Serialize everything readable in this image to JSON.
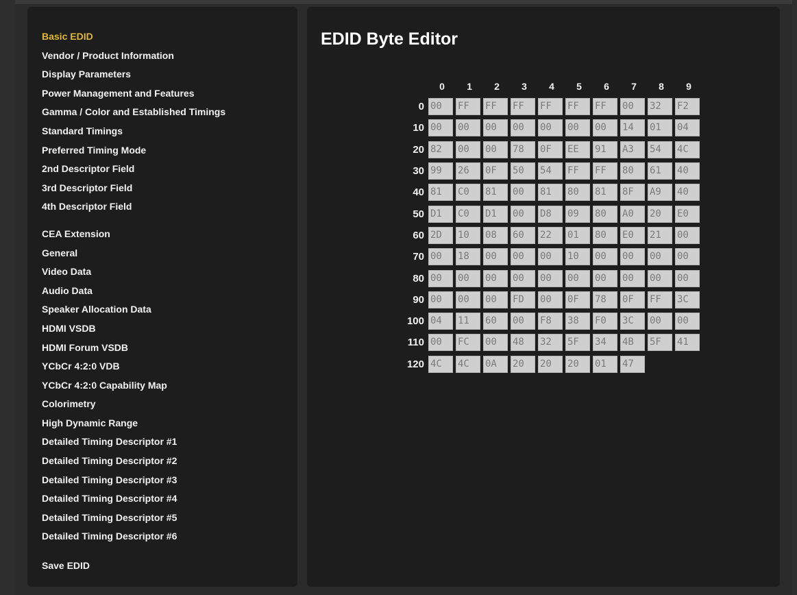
{
  "sidebar": {
    "edid_items": [
      "Basic EDID",
      "Vendor / Product Information",
      "Display Parameters",
      "Power Management and Features",
      "Gamma / Color and Established Timings",
      "Standard Timings",
      "Preferred Timing Mode",
      "2nd Descriptor Field",
      "3rd Descriptor Field",
      "4th Descriptor Field"
    ],
    "cea_items": [
      "CEA Extension",
      "General",
      "Video Data",
      "Audio Data",
      "Speaker Allocation Data",
      "HDMI VSDB",
      "HDMI Forum VSDB",
      "YCbCr 4:2:0 VDB",
      "YCbCr 4:2:0 Capability Map",
      "Colorimetry",
      "High Dynamic Range",
      "Detailed Timing Descriptor #1",
      "Detailed Timing Descriptor #2",
      "Detailed Timing Descriptor #3",
      "Detailed Timing Descriptor #4",
      "Detailed Timing Descriptor #5",
      "Detailed Timing Descriptor #6"
    ],
    "save_label": "Save EDID",
    "active_item": "Basic EDID"
  },
  "main": {
    "title": "EDID Byte Editor",
    "column_headers": [
      "0",
      "1",
      "2",
      "3",
      "4",
      "5",
      "6",
      "7",
      "8",
      "9"
    ],
    "rows": [
      {
        "label": "0",
        "bytes": [
          "00",
          "FF",
          "FF",
          "FF",
          "FF",
          "FF",
          "FF",
          "00",
          "32",
          "F2"
        ]
      },
      {
        "label": "10",
        "bytes": [
          "00",
          "00",
          "00",
          "00",
          "00",
          "00",
          "00",
          "14",
          "01",
          "04"
        ]
      },
      {
        "label": "20",
        "bytes": [
          "82",
          "00",
          "00",
          "78",
          "0F",
          "EE",
          "91",
          "A3",
          "54",
          "4C"
        ]
      },
      {
        "label": "30",
        "bytes": [
          "99",
          "26",
          "0F",
          "50",
          "54",
          "FF",
          "FF",
          "80",
          "61",
          "40"
        ]
      },
      {
        "label": "40",
        "bytes": [
          "81",
          "C0",
          "81",
          "00",
          "81",
          "80",
          "81",
          "8F",
          "A9",
          "40"
        ]
      },
      {
        "label": "50",
        "bytes": [
          "D1",
          "C0",
          "D1",
          "00",
          "D8",
          "09",
          "80",
          "A0",
          "20",
          "E0"
        ]
      },
      {
        "label": "60",
        "bytes": [
          "2D",
          "10",
          "08",
          "60",
          "22",
          "01",
          "80",
          "E0",
          "21",
          "00"
        ]
      },
      {
        "label": "70",
        "bytes": [
          "00",
          "18",
          "00",
          "00",
          "00",
          "10",
          "00",
          "00",
          "00",
          "00"
        ]
      },
      {
        "label": "80",
        "bytes": [
          "00",
          "00",
          "00",
          "00",
          "00",
          "00",
          "00",
          "00",
          "00",
          "00"
        ]
      },
      {
        "label": "90",
        "bytes": [
          "00",
          "00",
          "00",
          "FD",
          "00",
          "0F",
          "78",
          "0F",
          "FF",
          "3C"
        ]
      },
      {
        "label": "100",
        "bytes": [
          "04",
          "11",
          "60",
          "00",
          "F8",
          "38",
          "F0",
          "3C",
          "00",
          "00"
        ]
      },
      {
        "label": "110",
        "bytes": [
          "00",
          "FC",
          "00",
          "48",
          "32",
          "5F",
          "34",
          "4B",
          "5F",
          "41"
        ]
      },
      {
        "label": "120",
        "bytes": [
          "4C",
          "4C",
          "0A",
          "20",
          "20",
          "20",
          "01",
          "47"
        ]
      }
    ]
  },
  "colors": {
    "active_nav": "#e0b73c",
    "panel_bg": "#1d1d1d",
    "cell_bg": "#cfcfcf",
    "cell_text": "#7a7a7a"
  }
}
